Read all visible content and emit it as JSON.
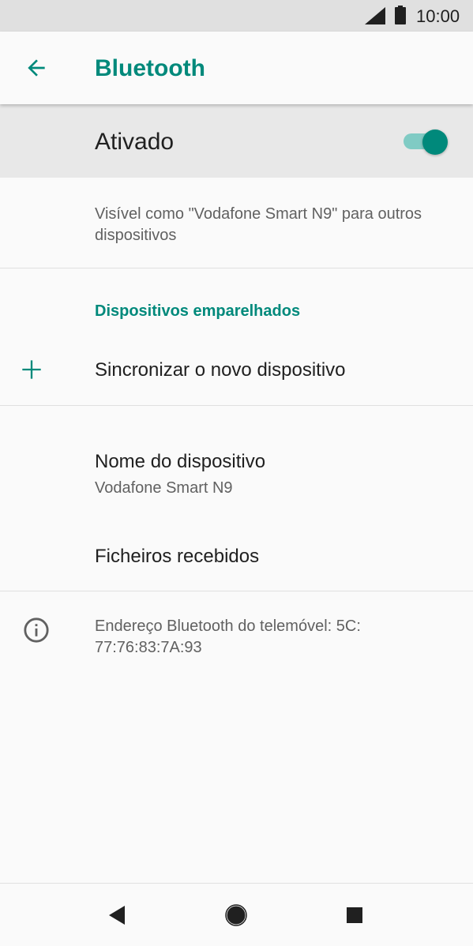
{
  "status_bar": {
    "time": "10:00",
    "icons": [
      "signal-icon",
      "battery-icon"
    ]
  },
  "app_bar": {
    "title": "Bluetooth",
    "back_icon": "arrow-left-icon"
  },
  "master_switch": {
    "label": "Ativado",
    "state": "on"
  },
  "visibility": {
    "text": "Visível como \"Vodafone Smart N9\" para outros dispositivos"
  },
  "paired_section": {
    "header": "Dispositivos emparelhados",
    "pair_new_label": "Sincronizar o novo dispositivo",
    "pair_new_icon": "plus-icon"
  },
  "device_name": {
    "title": "Nome do dispositivo",
    "value": "Vodafone Smart N9"
  },
  "received_files": {
    "title": "Ficheiros recebidos"
  },
  "address": {
    "icon": "info-icon",
    "text": "Endereço Bluetooth do telemóvel: 5C:\n77:76:83:7A:93"
  },
  "nav_bar": {
    "icons": [
      "nav-back-icon",
      "nav-home-icon",
      "nav-recents-icon"
    ]
  },
  "colors": {
    "accent": "#00897b",
    "toggle_track": "#80cbc4",
    "status_bar_bg": "#e0e0e0",
    "master_row_bg": "#e8e8e8"
  }
}
